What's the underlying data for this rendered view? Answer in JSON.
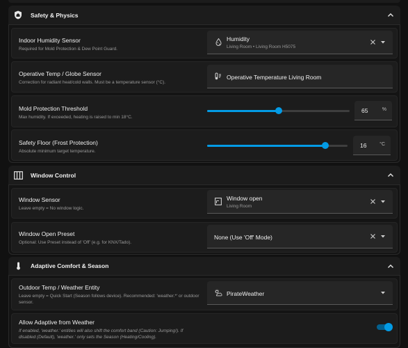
{
  "colors": {
    "accent": "#039be5",
    "background": "#111111",
    "card": "#1c1c1c",
    "field": "#262626"
  },
  "sections": {
    "safety": {
      "title": "Safety & Physics",
      "icon": "shield-home-icon",
      "humidity": {
        "label": "Indoor Humidity Sensor",
        "desc": "Required for Mold Protection & Dew Point Guard.",
        "value_title": "Humidity",
        "value_sub": "Living Room  •  Living Room H5075",
        "icon": "water-percent-icon"
      },
      "operative": {
        "label": "Operative Temp / Globe Sensor",
        "desc": "Correction for radiant heat/cold walls. Must be a temperature sensor (°C).",
        "value_title": "Operative Temperature Living Room",
        "icon": "thermometer-icon"
      },
      "mold": {
        "label": "Mold Protection Threshold",
        "desc": "Max humidity. If exceeded, heating is raised to min 18°C.",
        "value": "65",
        "unit": "%",
        "slider_fraction": 0.5
      },
      "frost": {
        "label": "Safety Floor (Frost Protection)",
        "desc": "Absolute minimum target temperature.",
        "value": "16",
        "unit": "°C",
        "slider_fraction": 0.84
      }
    },
    "window": {
      "title": "Window Control",
      "icon": "window-icon",
      "sensor": {
        "label": "Window Sensor",
        "desc": "Leave empty = No window logic.",
        "value_title": "Window open",
        "value_sub": "Living Room",
        "icon": "window-open-icon"
      },
      "preset": {
        "label": "Window Open Preset",
        "desc": "Optional: Use Preset instead of 'Off' (e.g. for KNX/Tado).",
        "value_title": "None (Use 'Off' Mode)"
      }
    },
    "adaptive": {
      "title": "Adaptive Comfort & Season",
      "icon": "thermometer-icon",
      "outdoor": {
        "label": "Outdoor Temp / Weather Entity",
        "desc_line1": "Leave empty = Quick Start (Season follows device). Recommended: 'weather.*' or outdoor",
        "desc_line2": "sensor.",
        "value_title": "PirateWeather",
        "icon": "weather-partly-cloudy-icon"
      },
      "allow": {
        "label": "Allow Adaptive from Weather",
        "desc_line1": "If enabled, 'weather.' entities will also shift the comfort band (Caution: Jumping!). If",
        "desc_line2": "disabled (Default), 'weather.' only sets the Season (Heating/Cooling).",
        "enabled": true
      }
    }
  }
}
